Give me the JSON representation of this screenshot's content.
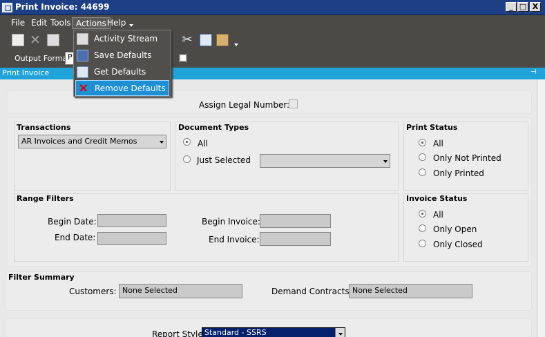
{
  "window": {
    "title": "Print Invoice: 44699",
    "min": "_",
    "max": "□",
    "close": "X"
  },
  "menubar": {
    "items": [
      "File",
      "Edit",
      "Tools",
      "Actions",
      "Help"
    ]
  },
  "actions_menu": {
    "items": [
      "Activity Stream",
      "Save Defaults",
      "Get Defaults",
      "Remove Defaults"
    ]
  },
  "toolbar": {
    "cut_glyph": "✂"
  },
  "format": {
    "label": "Output Format:",
    "value": "P"
  },
  "section": {
    "title": "Print Invoice"
  },
  "legal": {
    "label": "Assign Legal Number:"
  },
  "transactions": {
    "title": "Transactions",
    "value": "AR Invoices and Credit Memos"
  },
  "document_types": {
    "title": "Document Types",
    "all": "All",
    "just_selected": "Just Selected"
  },
  "print_status": {
    "title": "Print Status",
    "options": [
      "All",
      "Only Not Printed",
      "Only Printed"
    ]
  },
  "range_filters": {
    "title": "Range Filters",
    "begin_date": "Begin Date:",
    "end_date": "End Date:",
    "begin_invoice": "Begin Invoice:",
    "end_invoice": "End Invoice:"
  },
  "invoice_status": {
    "title": "Invoice Status",
    "options": [
      "All",
      "Only Open",
      "Only Closed"
    ]
  },
  "filter_summary": {
    "title": "Filter Summary",
    "customers_label": "Customers:",
    "customers_value": "None Selected",
    "contracts_label": "Demand Contracts:",
    "contracts_value": "None Selected"
  },
  "report": {
    "label": "Report Style:",
    "value": "Standard - SSRS"
  },
  "colors": {
    "title_bar": "#1c3f86",
    "menu_bar": "#4b4a47",
    "section_bar": "#1fa3d9",
    "highlight": "#1d8fd2"
  }
}
